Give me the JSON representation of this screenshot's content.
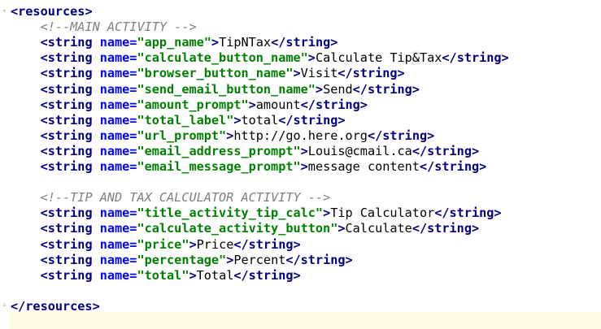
{
  "editor": {
    "lines": [
      {
        "indent": "",
        "kind": "open",
        "tag": "resources"
      },
      {
        "indent": "    ",
        "kind": "comment",
        "text": "<!--MAIN ACTIVITY -->"
      },
      {
        "indent": "    ",
        "kind": "string",
        "name": "app_name",
        "value": "TipNTax"
      },
      {
        "indent": "    ",
        "kind": "string",
        "name": "calculate_button_name",
        "value_pre": "Calculate Tip",
        "entity": "&",
        "value_post": "Tax"
      },
      {
        "indent": "    ",
        "kind": "string",
        "name": "browser_button_name",
        "value": "Visit"
      },
      {
        "indent": "    ",
        "kind": "string",
        "name": "send_email_button_name",
        "value": "Send"
      },
      {
        "indent": "    ",
        "kind": "string",
        "name": "amount_prompt",
        "value": "amount"
      },
      {
        "indent": "    ",
        "kind": "string",
        "name": "total_label",
        "value": "total"
      },
      {
        "indent": "    ",
        "kind": "string",
        "name": "url_prompt",
        "value": "http://go.here.org"
      },
      {
        "indent": "    ",
        "kind": "string",
        "name": "email_address_prompt",
        "value": "Louis@cmail.ca"
      },
      {
        "indent": "    ",
        "kind": "string",
        "name": "email_message_prompt",
        "value": "message content"
      },
      {
        "indent": "",
        "kind": "blank"
      },
      {
        "indent": "    ",
        "kind": "comment",
        "text": "<!--TIP AND TAX CALCULATOR ACTIVITY -->"
      },
      {
        "indent": "    ",
        "kind": "string",
        "name": "title_activity_tip_calc",
        "value": "Tip Calculator"
      },
      {
        "indent": "    ",
        "kind": "string",
        "name": "calculate_activity_button",
        "value": "Calculate"
      },
      {
        "indent": "    ",
        "kind": "string",
        "name": "price",
        "value": "Price"
      },
      {
        "indent": "    ",
        "kind": "string",
        "name": "percentage",
        "value": "Percent"
      },
      {
        "indent": "    ",
        "kind": "string",
        "name": "total",
        "value": "Total"
      },
      {
        "indent": "",
        "kind": "blank"
      },
      {
        "indent": "",
        "kind": "close",
        "tag": "resources"
      }
    ],
    "tokens": {
      "lt": "<",
      "gt": ">",
      "lt_slash": "</",
      "string_tag": "string",
      "name_attr": " name=",
      "quote": "\""
    }
  }
}
